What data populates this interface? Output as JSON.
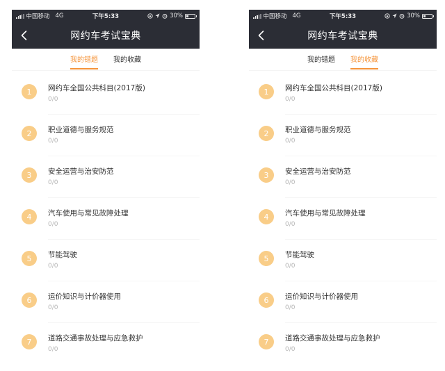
{
  "status_bar": {
    "carrier": "中国移动",
    "network": "4G",
    "time": "下午5:33",
    "battery": "30%",
    "battery_level": 0.3
  },
  "nav": {
    "title": "网约车考试宝典"
  },
  "tabs": [
    "我的错题",
    "我的收藏"
  ],
  "screens": [
    {
      "active_tab": 0
    },
    {
      "active_tab": 1
    }
  ],
  "items": [
    {
      "num": "1",
      "title": "网约车全国公共科目(2017版)",
      "progress": "0/0"
    },
    {
      "num": "2",
      "title": "职业道德与服务规范",
      "progress": "0/0"
    },
    {
      "num": "3",
      "title": "安全运营与治安防范",
      "progress": "0/0"
    },
    {
      "num": "4",
      "title": "汽车使用与常见故障处理",
      "progress": "0/0"
    },
    {
      "num": "5",
      "title": "节能驾驶",
      "progress": "0/0"
    },
    {
      "num": "6",
      "title": "运价知识与计价器使用",
      "progress": "0/0"
    },
    {
      "num": "7",
      "title": "道路交通事故处理与应急救护",
      "progress": "0/0"
    }
  ],
  "colors": {
    "header_bg": "#2b2d35",
    "accent": "#f5943a",
    "badge": "#f9cd88"
  }
}
